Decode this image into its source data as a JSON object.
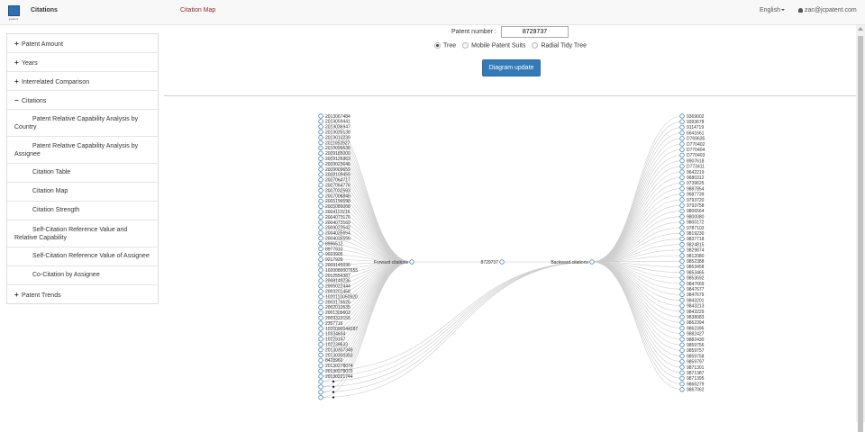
{
  "topbar": {
    "logo_text": "jcpatent",
    "brand": "Citations",
    "current_page": "Citation Map",
    "language": "English",
    "user_email": "zac@jcpatent.com"
  },
  "sidebar": {
    "items": [
      {
        "label": "Patent Amount",
        "sign": "+",
        "level": "top"
      },
      {
        "label": "Years",
        "sign": "+",
        "level": "top"
      },
      {
        "label": "Interrelated Comparison",
        "sign": "+",
        "level": "top"
      },
      {
        "label": "Citations",
        "sign": "−",
        "level": "top"
      },
      {
        "label": "Patent Relative Capability Analysis by Country",
        "level": "sub",
        "wrap": true
      },
      {
        "label": "Patent Relative Capability Analysis by Assignee",
        "level": "sub",
        "wrap": true
      },
      {
        "label": "Citation Table",
        "level": "sub"
      },
      {
        "label": "Citation Map",
        "level": "sub"
      },
      {
        "label": "Citation Strength",
        "level": "sub"
      },
      {
        "label": "Self-Citation Reference Value and Relative Capability",
        "level": "sub",
        "wrap": true
      },
      {
        "label": "Self-Citation Reference Value of Assignee",
        "level": "sub"
      },
      {
        "label": "Co-Citation by Assignee",
        "level": "sub"
      },
      {
        "label": "Patent Trends",
        "sign": "+",
        "level": "top"
      }
    ]
  },
  "form": {
    "patent_label": "Patent number :",
    "patent_value": "8729737",
    "options": [
      {
        "label": "Tree",
        "selected": true
      },
      {
        "label": "Mobile Patent Suits",
        "selected": false
      },
      {
        "label": "Radial Tidy Tree",
        "selected": false
      }
    ],
    "submit_label": "Diagram update"
  },
  "tree": {
    "root": "8729737",
    "forward_label": "Forward citations",
    "backward_label": "Backward citations",
    "forward": [
      "2013067484",
      "2013059441",
      "2013036947",
      "2013025138",
      "2013013239",
      "2011052627",
      "2010090636",
      "2009185000",
      "2009126963",
      "2009023646",
      "2009009659",
      "2008109459",
      "2007064717",
      "2007054776",
      "2007032593",
      "2007008846",
      "2005199598",
      "2005080068",
      "2004112216",
      "2004073176",
      "2004073169",
      "2009023542",
      "2004035654",
      "2004035556",
      "8996512",
      "8977910",
      "9023905",
      "9217929",
      "2009145036",
      "1020080007655",
      "2012554387",
      "2008149236",
      "2005022444",
      "2003201458",
      "1020110050920",
      "2003179526",
      "2002010535",
      "2001305603",
      "2009323155",
      "2357716",
      "1020090044287",
      "10334634",
      "10229147",
      "102239633",
      "20130307349",
      "20130300353",
      "8428960",
      "20130278074",
      "20130278073",
      "20130221744",
      "",
      "",
      "",
      ""
    ],
    "backward": [
      "9369002",
      "9393678",
      "9114719",
      "6641661",
      "D769635",
      "D770402",
      "D770404",
      "D770403",
      "8907618",
      "D773411",
      "9642219",
      "9680312",
      "9739625",
      "9887854",
      "9687739",
      "9793720",
      "9793758",
      "9806564",
      "9800080",
      "9800172",
      "9787103",
      "9819230",
      "9837718",
      "9824815",
      "9829874",
      "9812080",
      "9852388",
      "9853458",
      "9853465",
      "9853692",
      "9847669",
      "9847677",
      "9847679",
      "9843201",
      "9843213",
      "9843229",
      "9838083",
      "9862394",
      "9862395",
      "9882427",
      "9882430",
      "9859756",
      "9859757",
      "9859758",
      "9859797",
      "9871301",
      "9871387",
      "9871395",
      "9866279",
      "9867062"
    ]
  }
}
